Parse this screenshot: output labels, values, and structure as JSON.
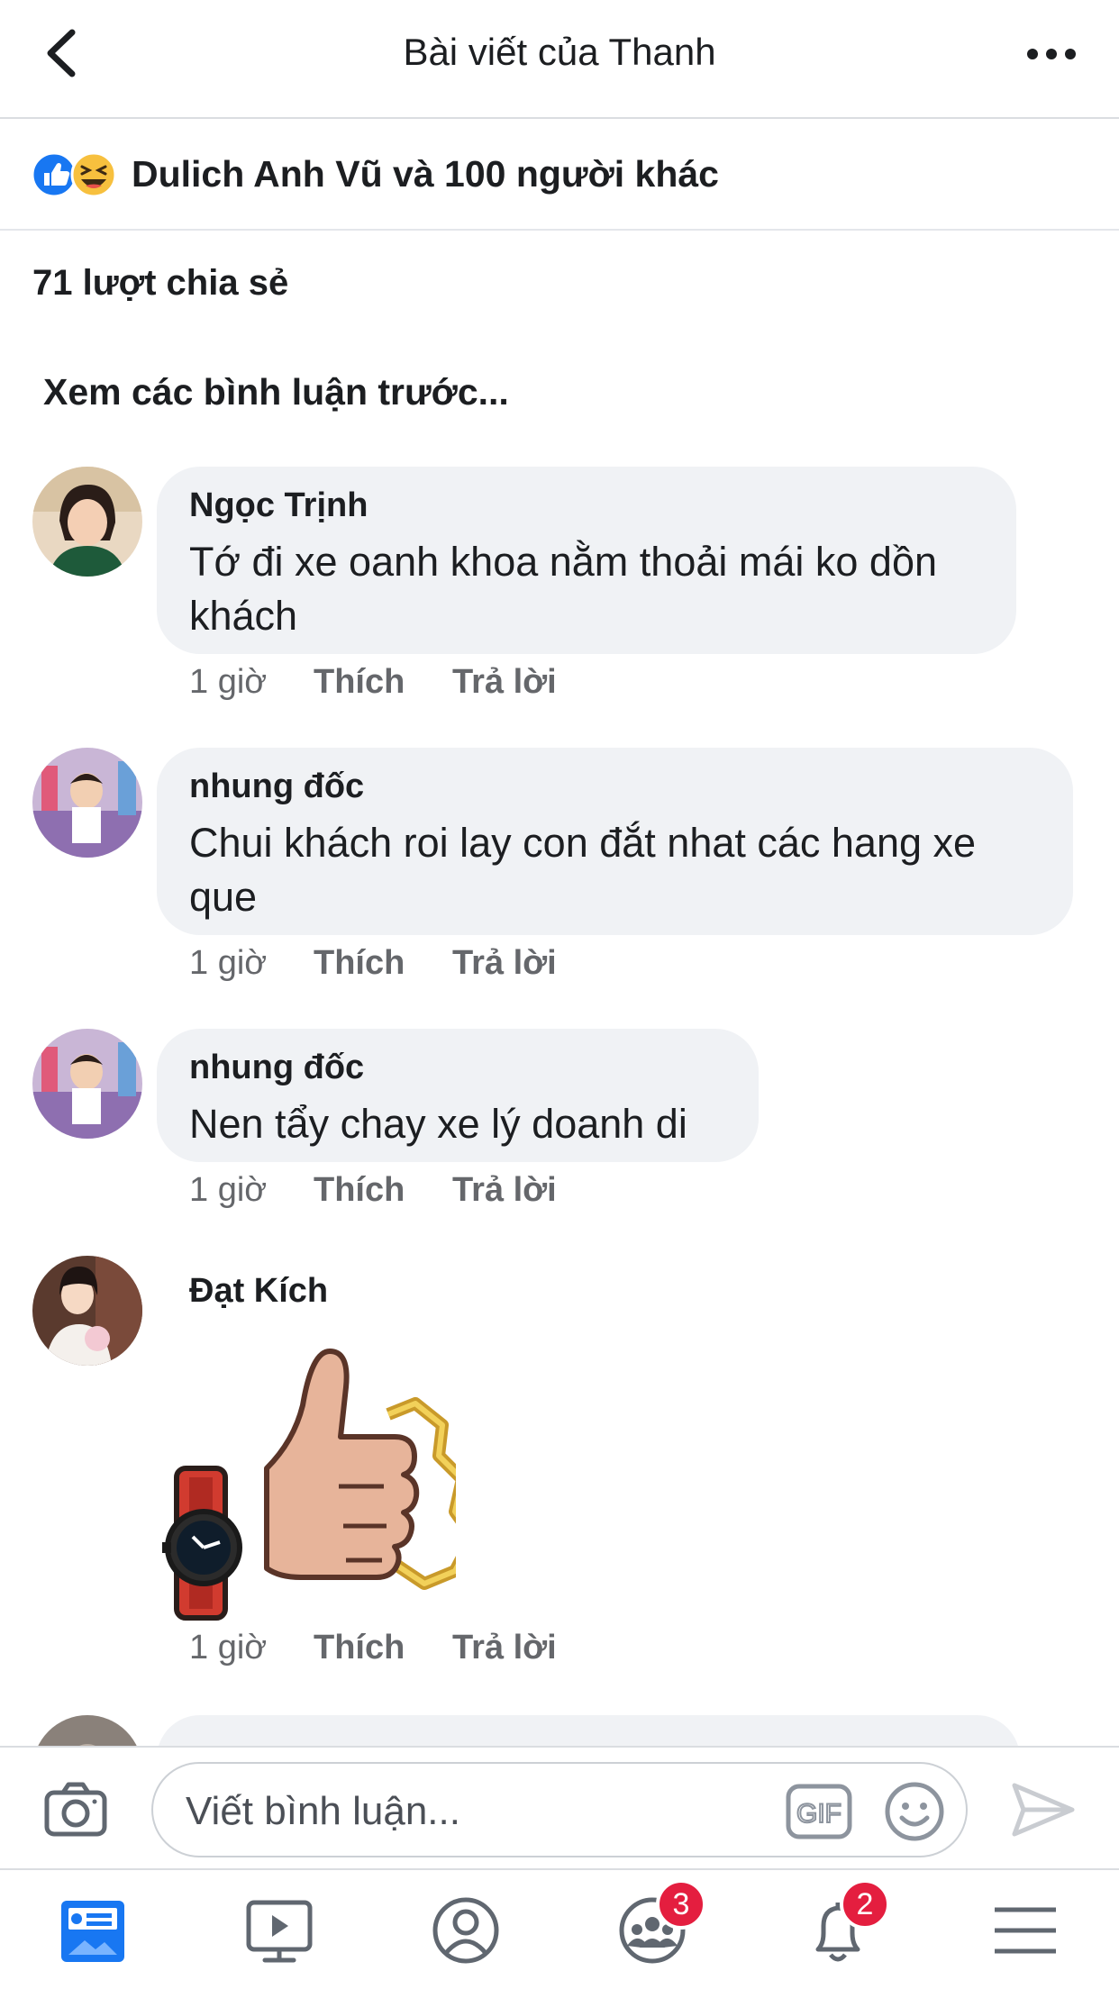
{
  "header": {
    "title": "Bài viết của Thanh",
    "back_icon": "chevron-left-icon",
    "more_icon": "ellipsis-icon"
  },
  "reactions": {
    "icons": [
      "like-icon",
      "haha-icon"
    ],
    "text": "Dulich Anh Vũ và 100 người khác"
  },
  "shares": "71 lượt chia sẻ",
  "previous_comments": "Xem các bình luận trước...",
  "comments": [
    {
      "author": "Ngọc Trịnh",
      "text_lines": [
        "Tớ đi xe oanh khoa nằm thoải mái ko dồn",
        "khách"
      ],
      "time": "1 giờ",
      "like": "Thích",
      "reply": "Trả lời"
    },
    {
      "author": "nhung đốc",
      "text_lines": [
        "Chui khách roi lay con đắt nhat các hang xe",
        "que"
      ],
      "time": "1 giờ",
      "like": "Thích",
      "reply": "Trả lời"
    },
    {
      "author": "nhung đốc",
      "text_lines": [
        "Nen tẩy chay xe lý doanh di"
      ],
      "time": "1 giờ",
      "like": "Thích",
      "reply": "Trả lời"
    },
    {
      "author": "Đạt Kích",
      "sticker": "thumbs-up-sticker",
      "time": "1 giờ",
      "like": "Thích",
      "reply": "Trả lời"
    }
  ],
  "composer": {
    "placeholder": "Viết bình luận...",
    "camera_icon": "camera-icon",
    "gif_label": "GIF",
    "emoji_icon": "emoji-icon",
    "send_icon": "send-icon"
  },
  "tabbar": {
    "tabs": [
      {
        "icon": "news-feed-icon",
        "active": true
      },
      {
        "icon": "watch-icon"
      },
      {
        "icon": "profile-icon"
      },
      {
        "icon": "groups-icon",
        "badge": "3"
      },
      {
        "icon": "notifications-icon",
        "badge": "2"
      },
      {
        "icon": "menu-icon"
      }
    ]
  },
  "colors": {
    "brand_blue": "#1877f2",
    "badge_red": "#e41e3f",
    "bubble_bg": "#f0f2f5",
    "meta_gray": "#65676b"
  }
}
